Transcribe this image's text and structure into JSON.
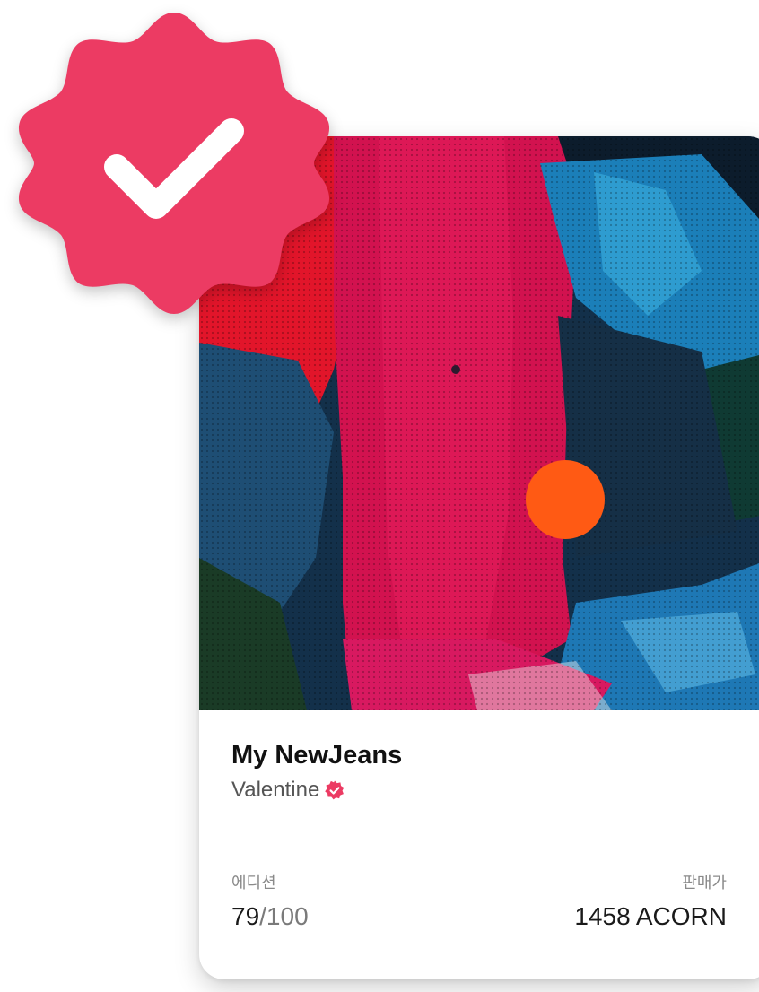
{
  "nft": {
    "title": "My NewJeans",
    "creator": "Valentine",
    "edition_label": "에디션",
    "edition_current": "79",
    "edition_total": "/100",
    "price_label": "판매가",
    "price_value": "1458 ACORN"
  },
  "icons": {
    "badge": "verified-badge-check-icon",
    "creator_verified": "verified-small-icon"
  },
  "colors": {
    "badge": "#EC3B63",
    "accent_dot": "#FF5A14"
  }
}
